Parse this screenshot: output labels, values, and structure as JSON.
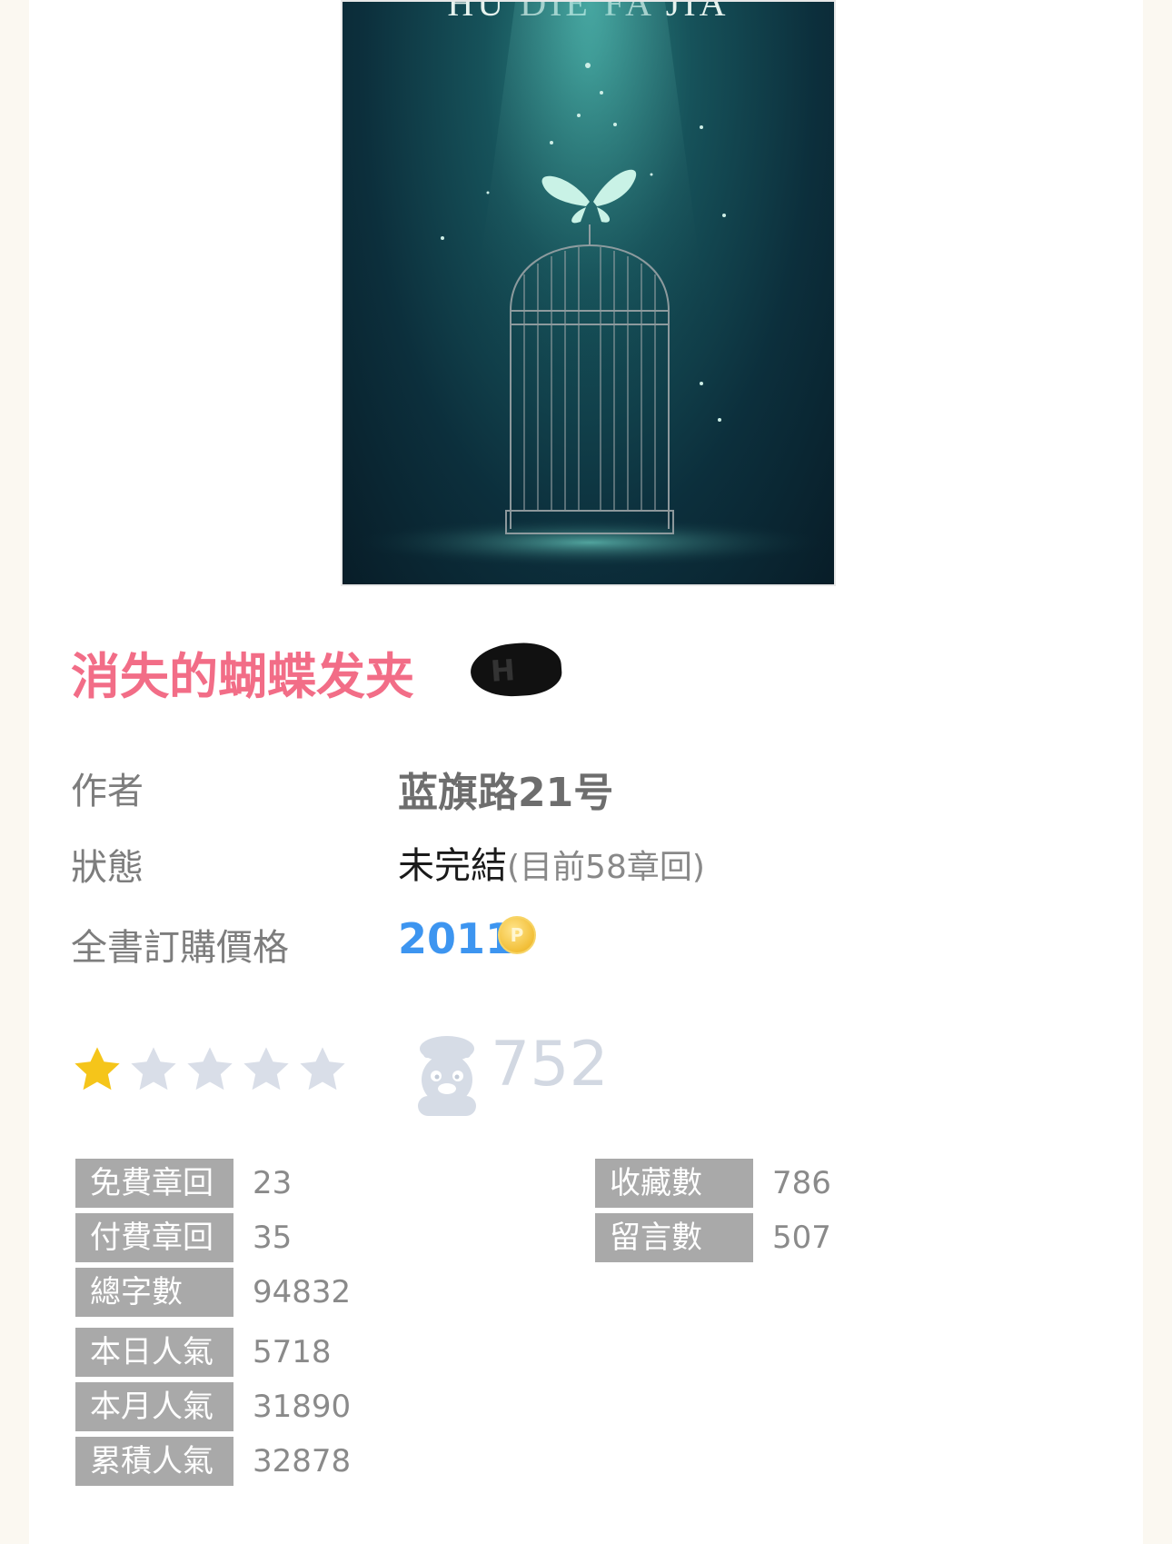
{
  "cover": {
    "title": "HU DIE FA JIA"
  },
  "book": {
    "title": "消失的蝴蝶发夹",
    "badge": "H"
  },
  "info": {
    "author_label": "作者",
    "author": "蓝旗路21号",
    "status_label": "狀態",
    "status": "未完結",
    "status_detail": "(目前58章回)",
    "price_label": "全書訂購價格",
    "price": "2011",
    "coin_symbol": "P",
    "coin_icon": "points-coin-icon"
  },
  "rating": {
    "stars_filled": 1,
    "stars_total": 5,
    "star_color": "#f5c51a",
    "star_empty_color": "#d9dee8",
    "favorites_icon": "mascot-icon",
    "favorites": "752"
  },
  "stats_left": [
    {
      "label": "免費章回",
      "value": "23"
    },
    {
      "label": "付費章回",
      "value": "35"
    },
    {
      "label": "總字數",
      "value": "94832"
    },
    {
      "label": "本日人氣",
      "value": "5718"
    },
    {
      "label": "本月人氣",
      "value": "31890"
    },
    {
      "label": "累積人氣",
      "value": "32878"
    }
  ],
  "stats_right": [
    {
      "label": "收藏數",
      "value": "786"
    },
    {
      "label": "留言數",
      "value": "507"
    }
  ],
  "colors": {
    "title": "#f26d87",
    "price": "#3d95f0",
    "stat_label_bg": "#a9a9a9"
  }
}
